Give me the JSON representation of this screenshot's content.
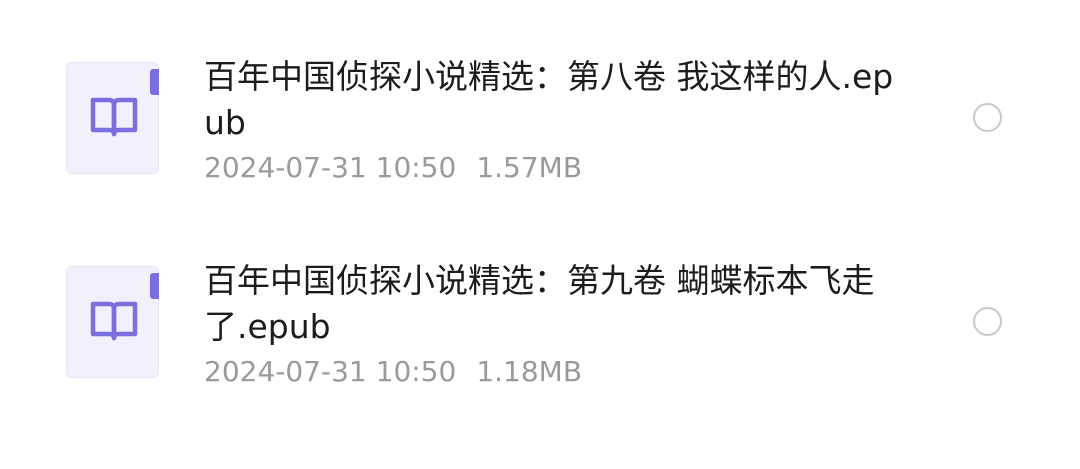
{
  "files": [
    {
      "name": "百年中国侦探小说精选：第八卷 我这样的人.epub",
      "date": "2024-07-31 10:50",
      "size": "1.57MB",
      "icon": "book-icon",
      "selected": false
    },
    {
      "name": "百年中国侦探小说精选：第九卷 蝴蝶标本飞走了.epub",
      "date": "2024-07-31 10:50",
      "size": "1.18MB",
      "icon": "book-icon",
      "selected": false
    }
  ],
  "colors": {
    "accent": "#7b6fe0",
    "icon_bg": "#f1f0fb",
    "text_primary": "#1c1c1c",
    "text_secondary": "#9a9a9a",
    "radio_border": "#c9c9c9"
  }
}
